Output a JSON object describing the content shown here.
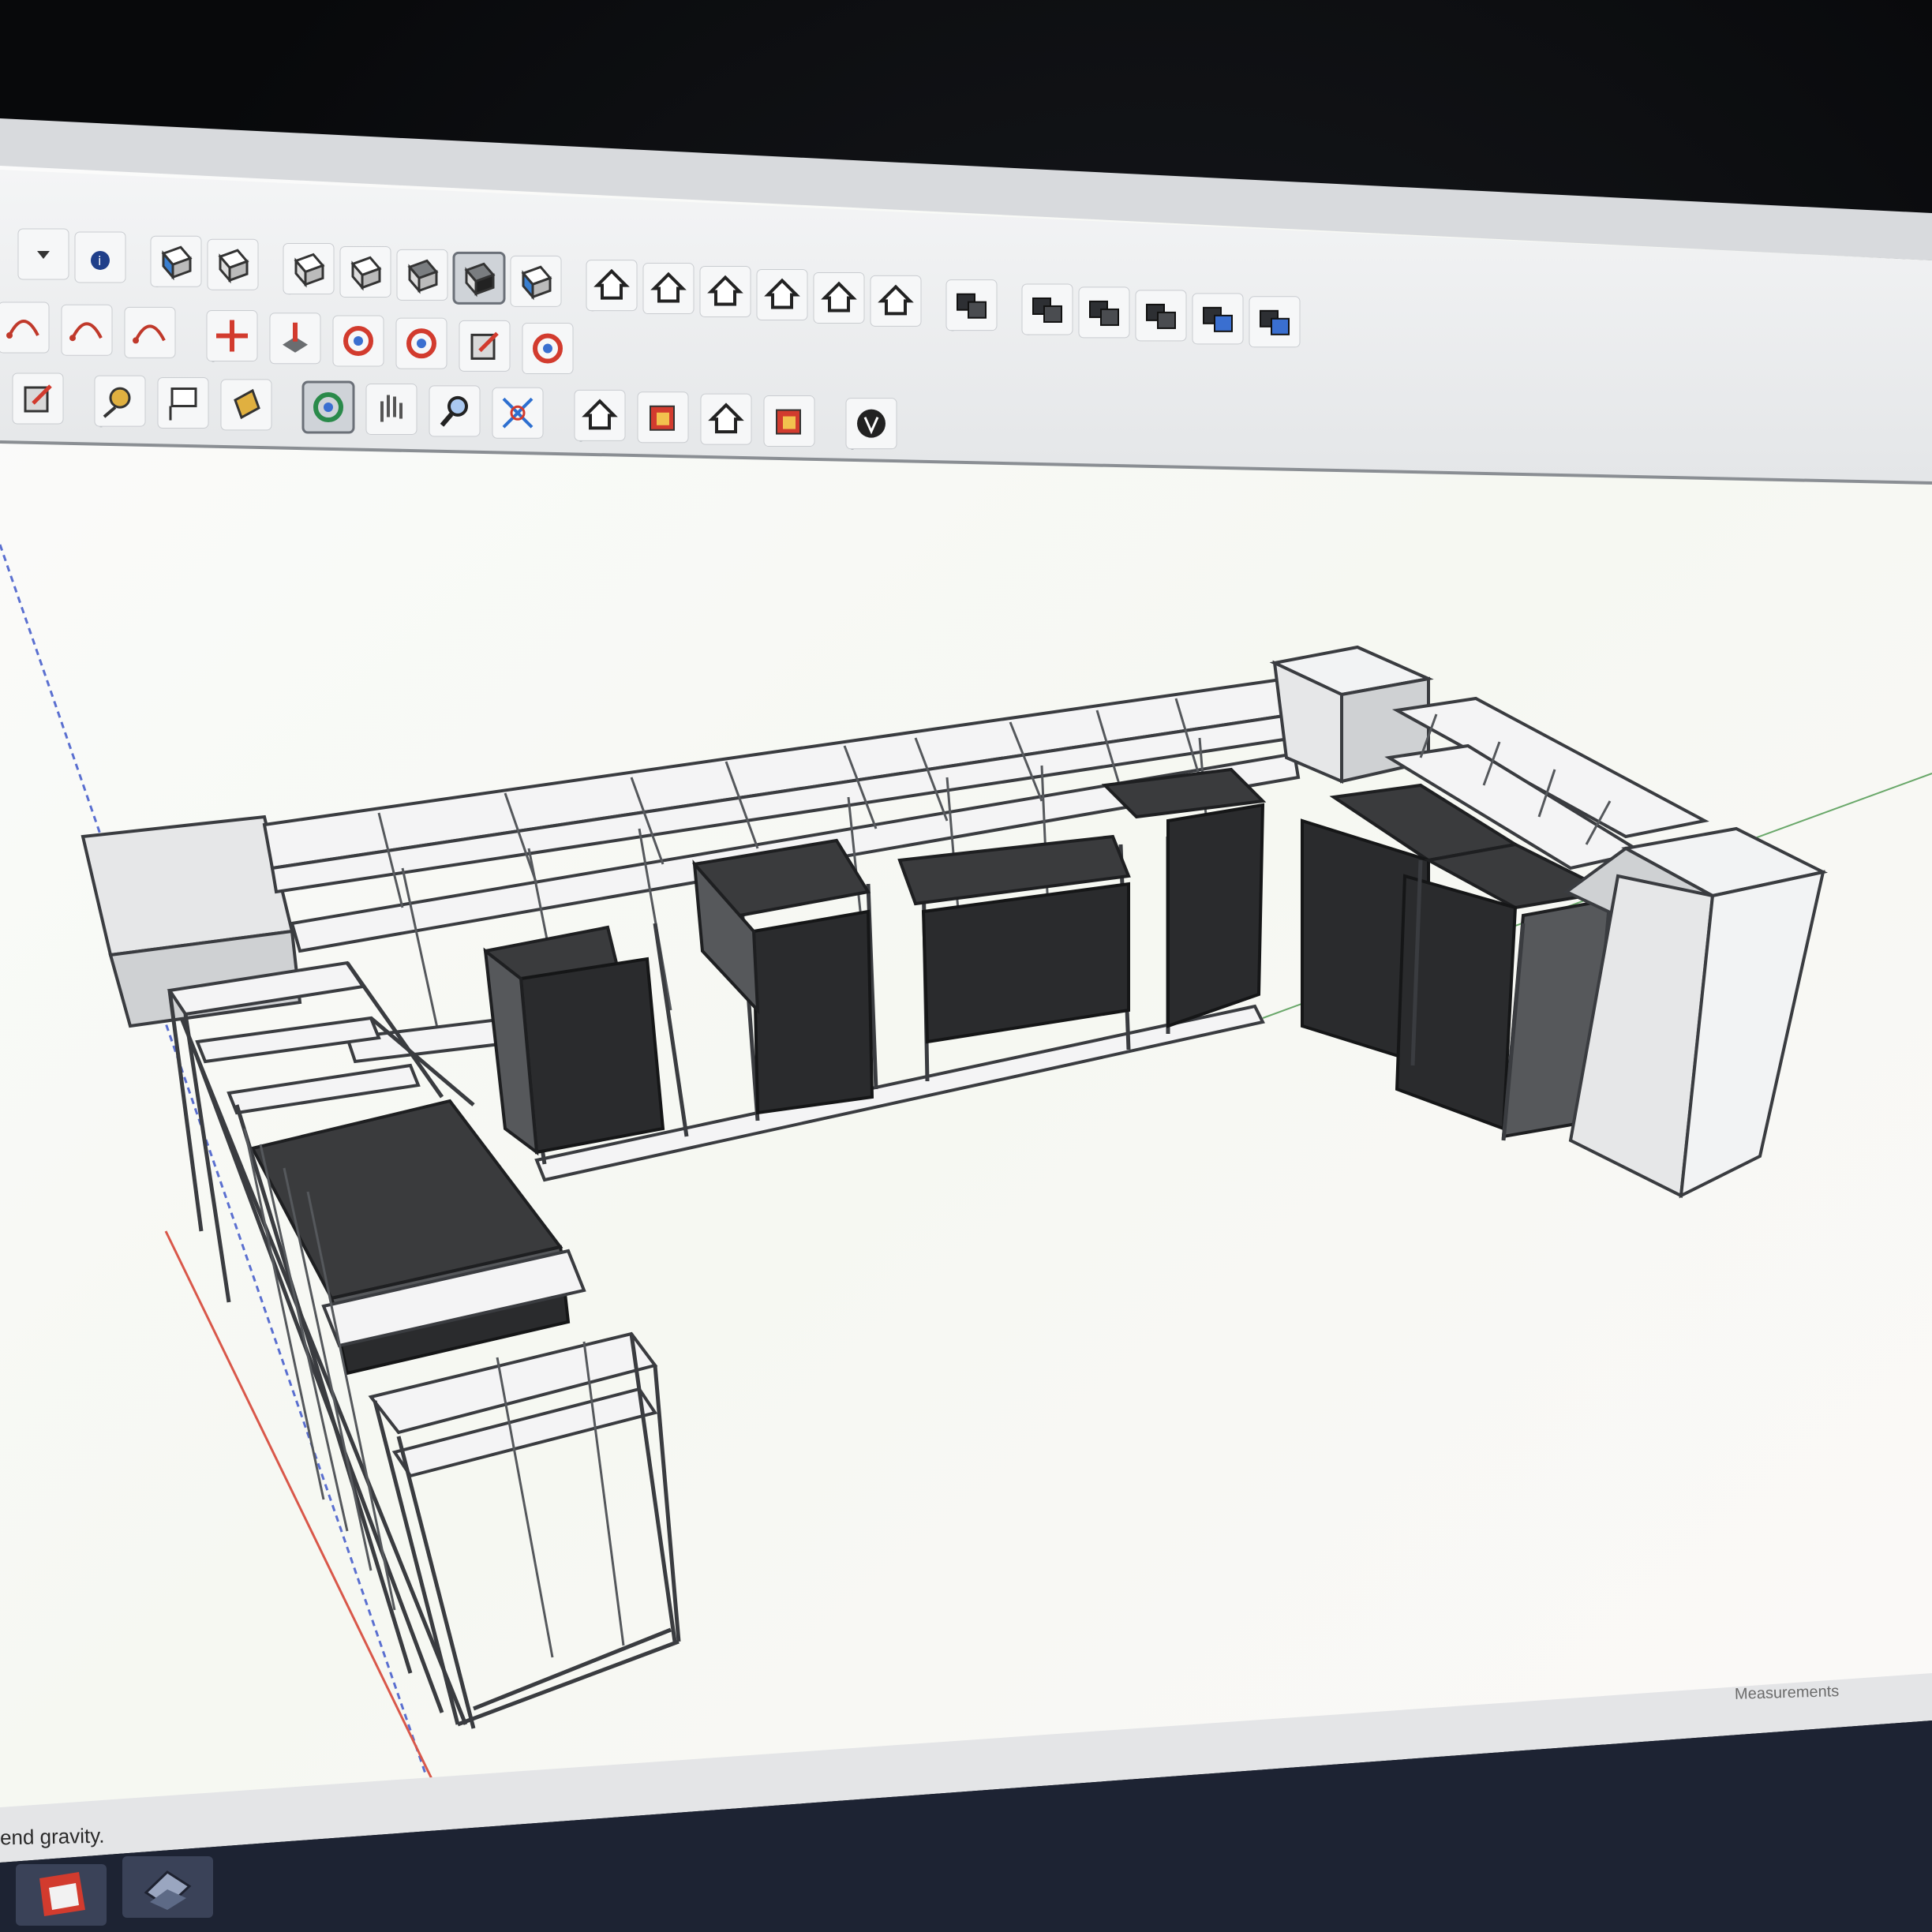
{
  "app": {
    "name": "SketchUp"
  },
  "toolbars": {
    "row1": [
      {
        "icon": "dropdown-arrow-icon"
      },
      {
        "icon": "entity-info-icon"
      },
      {
        "icon": "xray-style-icon"
      },
      {
        "icon": "back-edges-style-icon"
      },
      {
        "icon": "wireframe-style-icon"
      },
      {
        "icon": "hidden-line-style-icon"
      },
      {
        "icon": "shaded-style-icon"
      },
      {
        "icon": "shaded-with-textures-style-icon",
        "active": true
      },
      {
        "icon": "monochrome-style-icon"
      },
      {
        "icon": "iso-view-icon"
      },
      {
        "icon": "top-view-icon"
      },
      {
        "icon": "front-view-icon"
      },
      {
        "icon": "right-view-icon"
      },
      {
        "icon": "back-view-icon"
      },
      {
        "icon": "left-view-icon"
      },
      {
        "icon": "outer-shell-icon"
      },
      {
        "icon": "union-icon"
      },
      {
        "icon": "subtract-icon"
      },
      {
        "icon": "trim-icon"
      },
      {
        "icon": "intersect-icon"
      },
      {
        "icon": "split-icon"
      }
    ],
    "row2": [
      {
        "icon": "arc-icon"
      },
      {
        "icon": "two-point-arc-icon"
      },
      {
        "icon": "pie-icon"
      },
      {
        "icon": "move-icon"
      },
      {
        "icon": "push-pull-icon"
      },
      {
        "icon": "rotate-icon"
      },
      {
        "icon": "follow-me-icon"
      },
      {
        "icon": "scale-icon"
      },
      {
        "icon": "offset-icon"
      }
    ],
    "row3": [
      {
        "icon": "scale-small-icon"
      },
      {
        "icon": "tape-measure-icon"
      },
      {
        "icon": "text-label-icon"
      },
      {
        "icon": "paint-bucket-icon"
      },
      {
        "icon": "orbit-icon",
        "active": true
      },
      {
        "icon": "pan-icon"
      },
      {
        "icon": "zoom-icon"
      },
      {
        "icon": "zoom-extents-icon"
      },
      {
        "icon": "warehouse-icon"
      },
      {
        "icon": "share-model-icon"
      },
      {
        "icon": "extension-warehouse-icon"
      },
      {
        "icon": "send-to-layout-icon"
      },
      {
        "icon": "v-ray-icon"
      }
    ]
  },
  "status_bar": {
    "hint": "end gravity."
  },
  "measurements": {
    "label": "Measurements"
  },
  "taskbar": {
    "items": [
      {
        "icon": "sketchup-app-icon"
      },
      {
        "icon": "layout-app-icon"
      }
    ]
  },
  "colors": {
    "toolbar_bg": "#eceef0",
    "canvas_bg": "#fbfbfa",
    "dark_panel": "#3a3b3d",
    "red_axis": "#d9584a",
    "green_axis": "#6aa86a",
    "blue_axis": "#5a6fd0"
  }
}
